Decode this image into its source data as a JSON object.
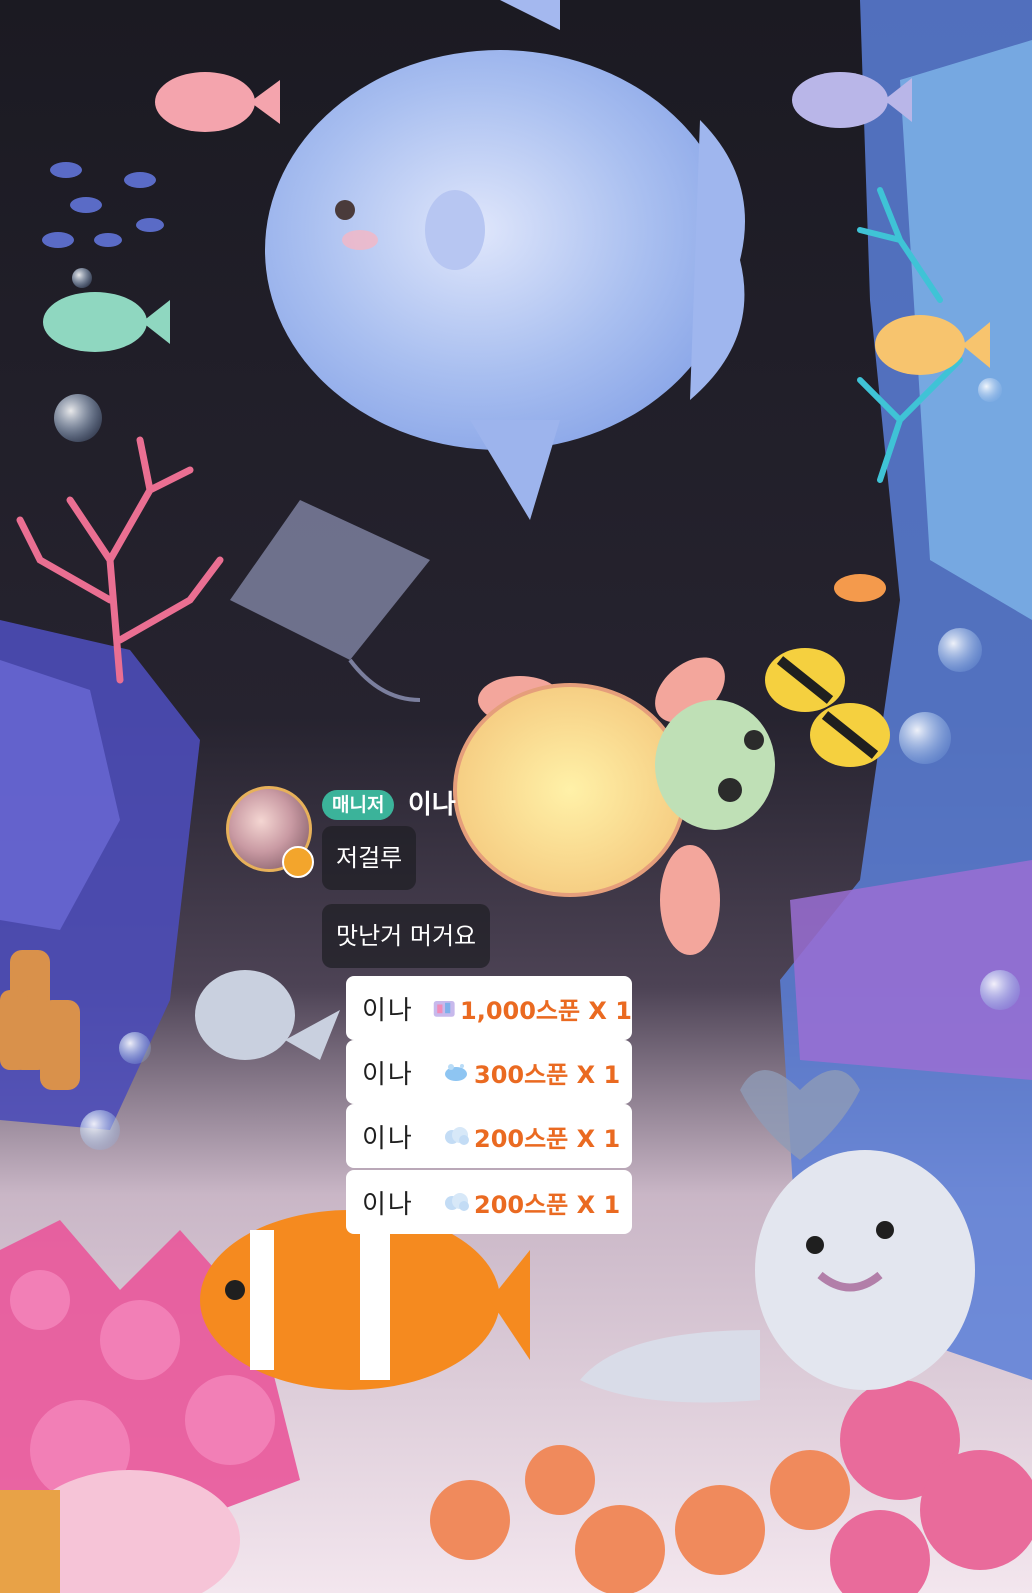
{
  "chat": {
    "manager_badge": "매니저",
    "sender_name": "이나",
    "messages": [
      "저걸루",
      "맛난거 머거요"
    ]
  },
  "gifts": [
    {
      "name": "이나",
      "amount": "1,000스푼 X 1",
      "icon": "spoon-bundle-icon"
    },
    {
      "name": "이나",
      "amount": "300스푼 X 1",
      "icon": "spoon-splash-icon"
    },
    {
      "name": "이나",
      "amount": "200스푼 X 1",
      "icon": "spoon-cloud-icon"
    },
    {
      "name": "이나",
      "amount": "200스푼 X 1",
      "icon": "spoon-cloud-icon"
    }
  ],
  "colors": {
    "background_dark": "#1d1c26",
    "manager_badge": "#3bb39a",
    "gift_amount": "#ea6a21",
    "avatar_ring": "#e7b15a"
  }
}
